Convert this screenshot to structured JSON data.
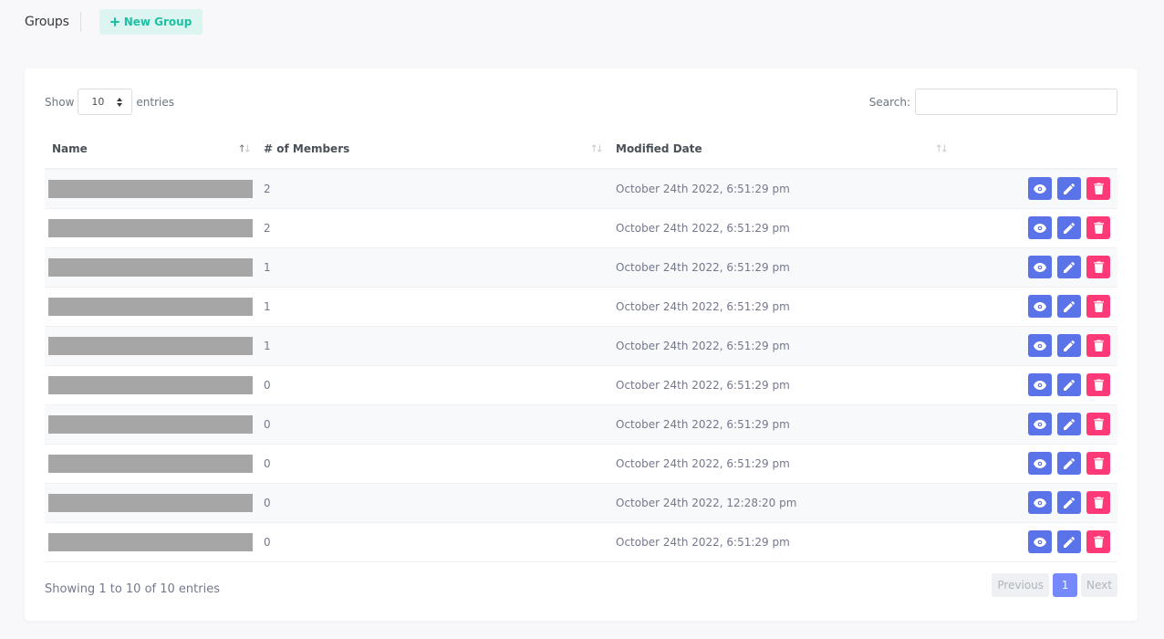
{
  "header": {
    "title": "Groups",
    "new_button_label": "New Group"
  },
  "controls": {
    "show_label": "Show",
    "length_value": "10",
    "entries_label": "entries",
    "search_label": "Search:",
    "search_value": ""
  },
  "table": {
    "columns": [
      "Name",
      "# of Members",
      "Modified Date"
    ],
    "rows": [
      {
        "members": "2",
        "modified": "October 24th 2022, 6:51:29 pm"
      },
      {
        "members": "2",
        "modified": "October 24th 2022, 6:51:29 pm"
      },
      {
        "members": "1",
        "modified": "October 24th 2022, 6:51:29 pm"
      },
      {
        "members": "1",
        "modified": "October 24th 2022, 6:51:29 pm"
      },
      {
        "members": "1",
        "modified": "October 24th 2022, 6:51:29 pm"
      },
      {
        "members": "0",
        "modified": "October 24th 2022, 6:51:29 pm"
      },
      {
        "members": "0",
        "modified": "October 24th 2022, 6:51:29 pm"
      },
      {
        "members": "0",
        "modified": "October 24th 2022, 6:51:29 pm"
      },
      {
        "members": "0",
        "modified": "October 24th 2022, 12:28:20 pm"
      },
      {
        "members": "0",
        "modified": "October 24th 2022, 6:51:29 pm"
      }
    ]
  },
  "footer": {
    "info": "Showing 1 to 10 of 10 entries",
    "prev_label": "Previous",
    "current_page": "1",
    "next_label": "Next"
  },
  "icons": {
    "view": "eye-icon",
    "edit": "pencil-icon",
    "delete": "trash-icon",
    "add": "plus-icon"
  },
  "colors": {
    "accent": "#5b73e8",
    "danger": "#fd3977",
    "success": "#1fbfa1"
  }
}
